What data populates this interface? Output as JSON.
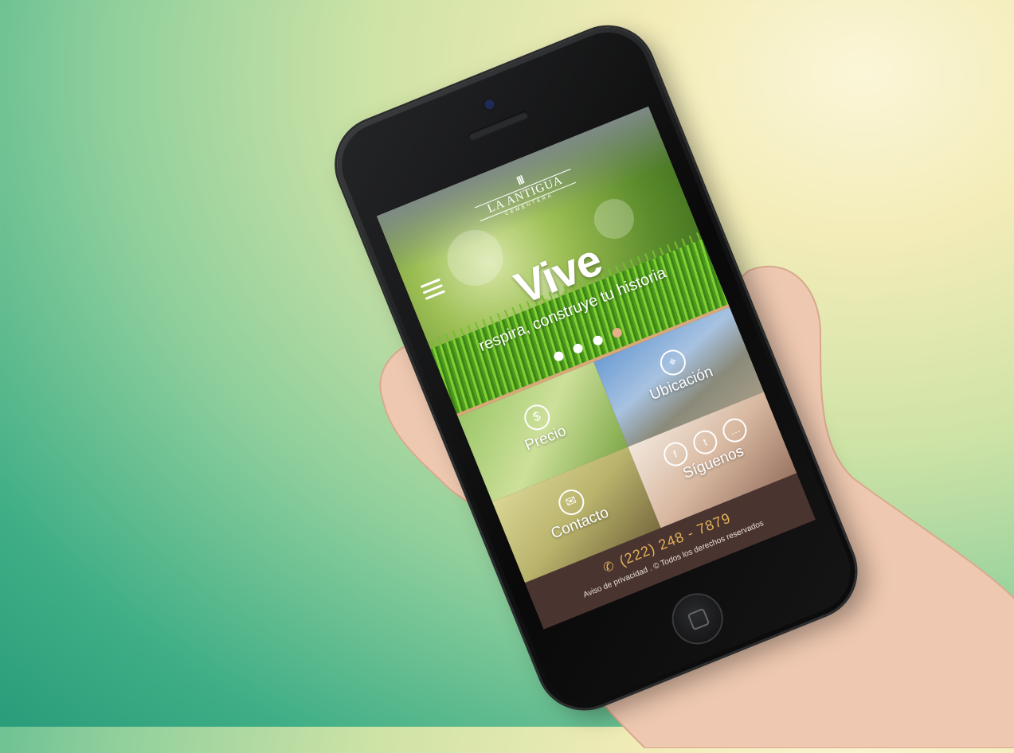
{
  "app": {
    "logo_mark": "ııı",
    "logo_name": "LA ANTIGUA",
    "logo_sub": "CEMENTERA"
  },
  "hero": {
    "title": "Vive",
    "tagline": "respira, construye tu historia",
    "slides": 4,
    "active_slide": 4
  },
  "tiles": [
    {
      "label": "Precio",
      "icon": "dollar-icon",
      "glyph": "$"
    },
    {
      "label": "Ubicación",
      "icon": "map-pin-icon",
      "glyph": "⌖"
    },
    {
      "label": "Contacto",
      "icon": "envelope-icon",
      "glyph": "✉"
    },
    {
      "label": "Síguenos",
      "icon": "social-icons"
    }
  ],
  "social": {
    "facebook": "f",
    "twitter": "t",
    "chat": "…"
  },
  "footer": {
    "phone": "(222) 248 - 7879",
    "privacy": "Aviso de privacidad",
    "separator": ".",
    "copyright": "© Todos los derechos reservados"
  },
  "colors": {
    "footer_bg": "#4a3430",
    "phone_color": "#e1b15a",
    "active_dot": "#e7b08a"
  }
}
